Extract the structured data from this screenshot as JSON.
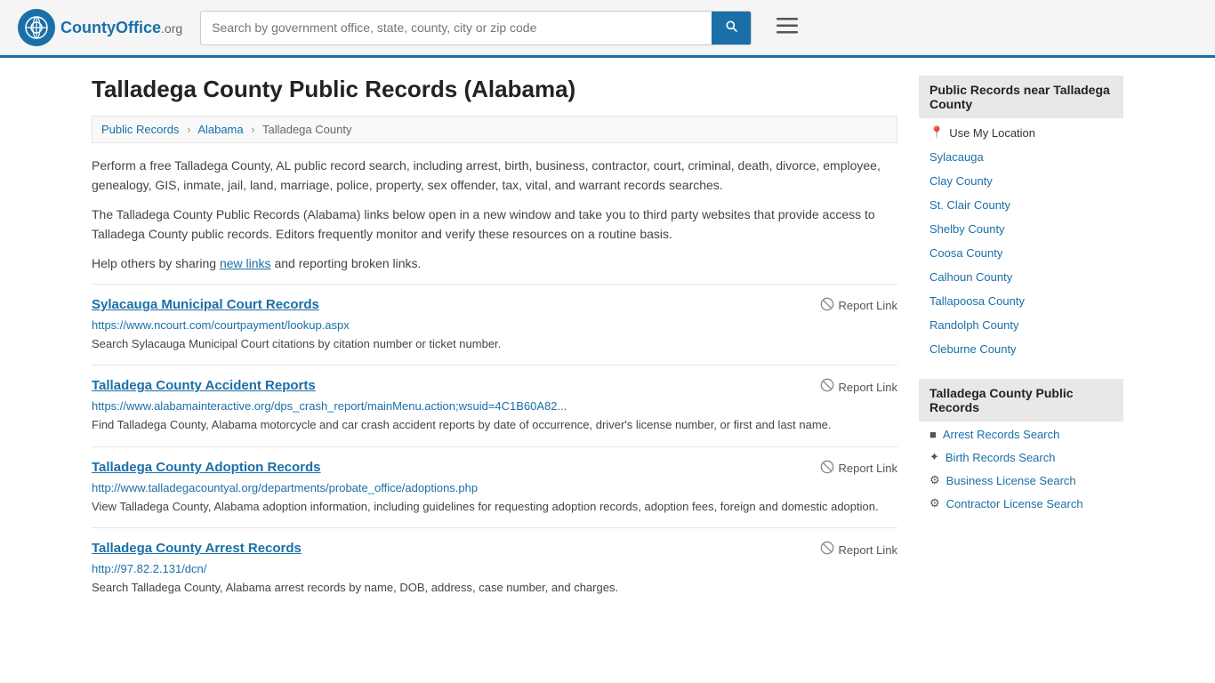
{
  "header": {
    "logo_text": "CountyOffice",
    "logo_org": ".org",
    "search_placeholder": "Search by government office, state, county, city or zip code"
  },
  "page": {
    "title": "Talladega County Public Records (Alabama)",
    "breadcrumb": {
      "items": [
        "Public Records",
        "Alabama",
        "Talladega County"
      ]
    },
    "description1": "Perform a free Talladega County, AL public record search, including arrest, birth, business, contractor, court, criminal, death, divorce, employee, genealogy, GIS, inmate, jail, land, marriage, police, property, sex offender, tax, vital, and warrant records searches.",
    "description2": "The Talladega County Public Records (Alabama) links below open in a new window and take you to third party websites that provide access to Talladega County public records. Editors frequently monitor and verify these resources on a routine basis.",
    "description3_pre": "Help others by sharing ",
    "description3_link": "new links",
    "description3_post": " and reporting broken links.",
    "records": [
      {
        "title": "Sylacauga Municipal Court Records",
        "url": "https://www.ncourt.com/courtpayment/lookup.aspx",
        "description": "Search Sylacauga Municipal Court citations by citation number or ticket number."
      },
      {
        "title": "Talladega County Accident Reports",
        "url": "https://www.alabamainteractive.org/dps_crash_report/mainMenu.action;wsuid=4C1B60A82...",
        "description": "Find Talladega County, Alabama motorcycle and car crash accident reports by date of occurrence, driver's license number, or first and last name."
      },
      {
        "title": "Talladega County Adoption Records",
        "url": "http://www.talladegacountyal.org/departments/probate_office/adoptions.php",
        "description": "View Talladega County, Alabama adoption information, including guidelines for requesting adoption records, adoption fees, foreign and domestic adoption."
      },
      {
        "title": "Talladega County Arrest Records",
        "url": "http://97.82.2.131/dcn/",
        "description": "Search Talladega County, Alabama arrest records by name, DOB, address, case number, and charges."
      }
    ],
    "report_link_label": "Report Link"
  },
  "sidebar": {
    "nearby_title": "Public Records near Talladega County",
    "use_location": "Use My Location",
    "nearby_items": [
      "Sylacauga",
      "Clay County",
      "St. Clair County",
      "Shelby County",
      "Coosa County",
      "Calhoun County",
      "Tallapoosa County",
      "Randolph County",
      "Cleburne County"
    ],
    "records_title": "Talladega County Public Records",
    "record_links": [
      {
        "label": "Arrest Records Search",
        "icon": "■"
      },
      {
        "label": "Birth Records Search",
        "icon": "✦"
      },
      {
        "label": "Business License Search",
        "icon": "⚙"
      },
      {
        "label": "Contractor License Search",
        "icon": "⚙"
      }
    ]
  }
}
